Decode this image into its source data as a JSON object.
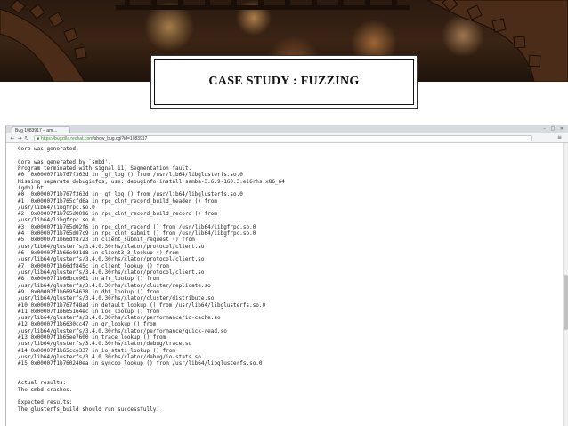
{
  "slide": {
    "title": "CASE STUDY : FUZZING"
  },
  "browser": {
    "tab_title": "Bug 1083917 – aml...",
    "window_controls": "– □ ✕",
    "url_host": "https://bugzilla.redhat.com",
    "url_path": "/show_bug.cgi?id=1083917",
    "icons": {
      "back": "back-arrow-icon",
      "forward": "forward-arrow-icon",
      "reload": "reload-icon",
      "lock": "lock-icon",
      "menu": "menu-icon"
    }
  },
  "report": {
    "lines": [
      "Core was generated:",
      "",
      "Core was generated by `smbd'.",
      "Program terminated with signal 11, Segmentation fault.",
      "#0  0x00007f1b767f363d in _gf_log () from /usr/lib64/libglusterfs.so.0",
      "Missing separate debuginfos, use: debuginfo-install samba-3.6.9-160.3.el6rhs.x86_64",
      "(gdb) bt",
      "#0  0x00007f1b767f363d in _gf_log () from /usr/lib64/libglusterfs.so.0",
      "#1  0x00007f1b765cfd6a in rpc_clnt_record_build_header () from",
      "/usr/lib64/libgfrpc.so.0",
      "#2  0x00007f1b765d0096 in rpc_clnt_record_build_record () from",
      "/usr/lib64/libgfrpc.so.0",
      "#3  0x00007f1b765d02f6 in rpc_clnt_record () from /usr/lib64/libgfrpc.so.0",
      "#4  0x00007f1b765d07c9 in rpc_clnt_submit () from /usr/lib64/libgfrpc.so.0",
      "#5  0x00007f1b66df8723 in client_submit_request () from",
      "/usr/lib64/glusterfs/3.4.0.30rhs/xlator/protocol/client.so",
      "#6  0x00007f1b66e031d8 in client3_3_lookup () from",
      "/usr/lib64/glusterfs/3.4.0.30rhs/xlator/protocol/client.so",
      "#7  0x00007f1b66df845c in client_lookup () from",
      "/usr/lib64/glusterfs/3.4.0.30rhs/xlator/protocol/client.so",
      "#8  0x00007f1b66bce961 in afr_lookup () from",
      "/usr/lib64/glusterfs/3.4.0.30rhs/xlator/cluster/replicate.so",
      "#9  0x00007f1b66954638 in dht_lookup () from",
      "/usr/lib64/glusterfs/3.4.0.30rhs/xlator/cluster/distribute.so",
      "#10 0x00007f1b767f48ad in default_lookup () from /usr/lib64/libglusterfs.so.0",
      "#11 0x00007f1b665164ec in ioc_lookup () from",
      "/usr/lib64/glusterfs/3.4.0.30rhs/xlator/performance/io-cache.so",
      "#12 0x00007f1b6630cc47 in qr_lookup () from",
      "/usr/lib64/glusterfs/3.4.0.30rhs/xlator/performance/quick-read.so",
      "#13 0x00007f1b65ee7600 in trace_lookup () from",
      "/usr/lib64/glusterfs/3.4.0.30rhs/xlator/debug/trace.so",
      "#14 0x00007f1b65cce337 in io_stats_lookup () from",
      "/usr/lib64/glusterfs/3.4.0.30rhs/xlator/debug/io-stats.so",
      "#15 0x00007f1b760240ea in syncop_lookup () from /usr/lib64/libglusterfs.so.0",
      "",
      "",
      "Actual results:",
      "The smbd crashes.",
      "",
      "Expected results:",
      "The glusterfs_build should run successfully."
    ]
  }
}
